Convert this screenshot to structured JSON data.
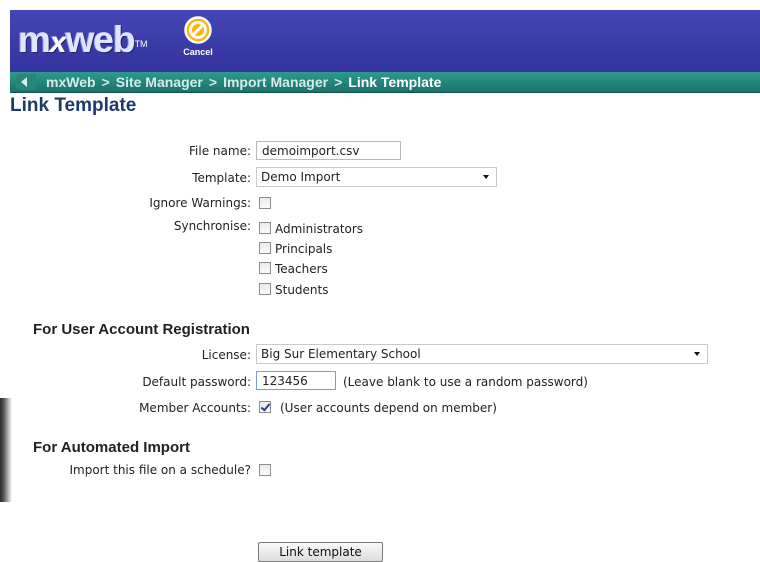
{
  "header": {
    "logo_text": "mxweb",
    "logo_trademark": "TM",
    "cancel_label": "Cancel",
    "cancel_icon": "cancel-icon",
    "bg_color": "#3c3caa"
  },
  "breadcrumb": {
    "back_icon": "back-arrow-icon",
    "items": [
      "mxWeb",
      "Site Manager",
      "Import Manager",
      "Link Template"
    ],
    "separator": ">",
    "bg_color": "#238478"
  },
  "page": {
    "title": "Link Template",
    "title_color": "#1d3a6a"
  },
  "form": {
    "file_name_label": "File name:",
    "file_name_value": "demoimport.csv",
    "template_label": "Template:",
    "template_value": "Demo Import",
    "ignore_warnings_label": "Ignore Warnings:",
    "ignore_warnings_checked": false,
    "synchronise_label": "Synchronise:",
    "synchronise_options": [
      {
        "label": "Administrators",
        "checked": false
      },
      {
        "label": "Principals",
        "checked": false
      },
      {
        "label": "Teachers",
        "checked": false
      },
      {
        "label": "Students",
        "checked": false
      }
    ]
  },
  "registration": {
    "heading": "For User Account Registration",
    "license_label": "License:",
    "license_value": "Big Sur Elementary School",
    "default_password_label": "Default password:",
    "default_password_value": "123456",
    "default_password_hint": "(Leave blank to use a random password)",
    "member_accounts_label": "Member Accounts:",
    "member_accounts_checked": true,
    "member_accounts_hint": "(User accounts depend on member)"
  },
  "automated": {
    "heading": "For Automated Import",
    "schedule_label": "Import this file on a schedule?",
    "schedule_checked": false
  },
  "actions": {
    "submit_label": "Link template"
  }
}
